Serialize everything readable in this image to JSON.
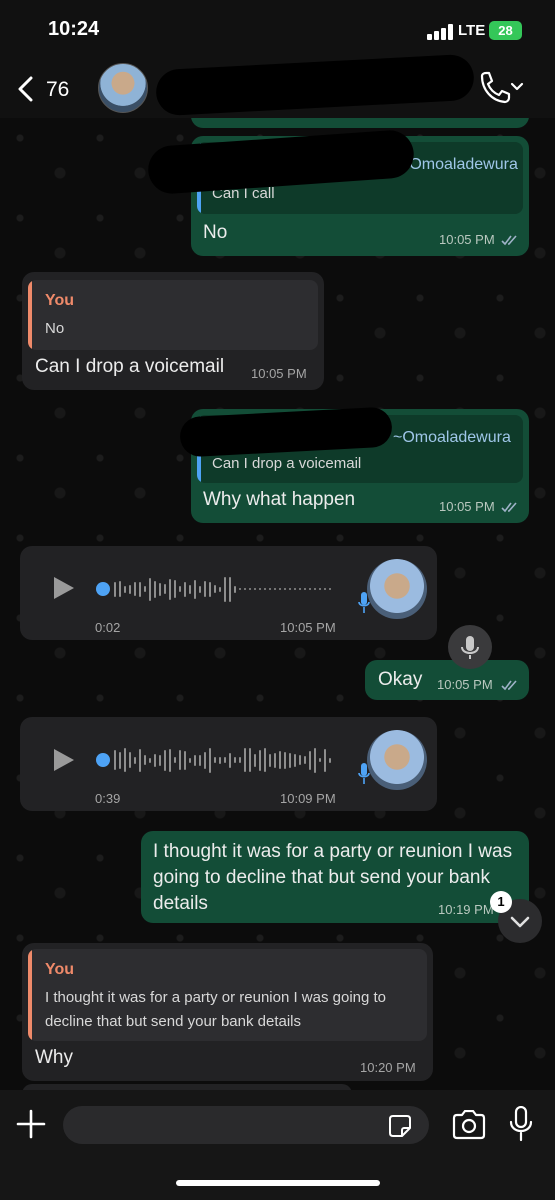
{
  "status_bar": {
    "time": "10:24",
    "network": "LTE",
    "battery": "28"
  },
  "header": {
    "back_count": "76"
  },
  "messages": [
    {
      "id": "m1",
      "quote_name": "~Omoaladewura",
      "quote_text": "Can I call",
      "text": "No",
      "time": "10:05 PM"
    },
    {
      "id": "m2",
      "quote_name": "You",
      "quote_text": "No",
      "text": "Can I drop a voicemail",
      "time": "10:05 PM"
    },
    {
      "id": "m3",
      "quote_name": "~Omoaladewura",
      "quote_text": "Can I drop a voicemail",
      "text": "Why what happen",
      "time": "10:05 PM"
    },
    {
      "id": "v1",
      "duration": "0:02",
      "time": "10:05 PM"
    },
    {
      "id": "m4",
      "text": "Okay",
      "time": "10:05 PM"
    },
    {
      "id": "v2",
      "duration": "0:39",
      "time": "10:09 PM"
    },
    {
      "id": "m5",
      "text": "I thought it was for a party or reunion I was going to decline that but send your bank details",
      "time": "10:19 PM"
    },
    {
      "id": "m6",
      "quote_name": "You",
      "quote_text": "I thought it was for a party or reunion I was going to decline that but send your bank details",
      "text": "Why",
      "time": "10:20 PM"
    }
  ],
  "unread_badge": "1",
  "input": {
    "placeholder": ""
  },
  "colors": {
    "outgoing": "#134d37",
    "incoming": "#222224",
    "quote_you": "#ef8a6a",
    "quote_other": "#4ea3f5",
    "ticks": "#9fb3c8"
  }
}
